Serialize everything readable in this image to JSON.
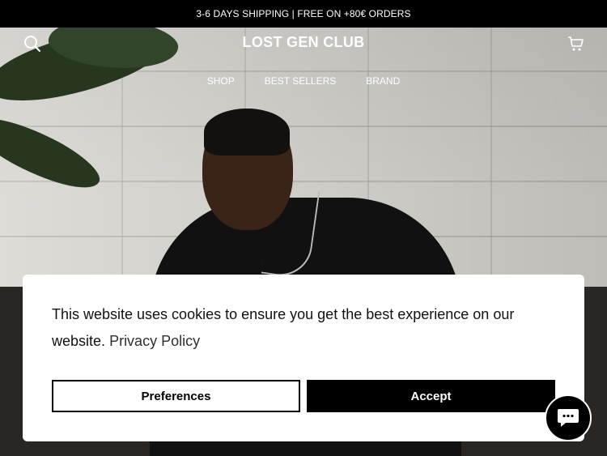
{
  "announcement": {
    "text": "3-6 DAYS SHIPPING | FREE ON +80€ ORDERS"
  },
  "header": {
    "logo": "LOST GEN CLUB",
    "search_icon": "search-icon",
    "cart_icon": "cart-icon"
  },
  "nav": {
    "items": [
      {
        "label": "SHOP"
      },
      {
        "label": "BEST SELLERS"
      },
      {
        "label": "BRAND"
      }
    ]
  },
  "cookie_banner": {
    "message": "This website uses cookies to ensure you get the best experience on our website.",
    "link_label": "Privacy Policy",
    "preferences_label": "Preferences",
    "accept_label": "Accept"
  },
  "chat": {
    "icon": "chat-icon"
  },
  "colors": {
    "announce_bg": "#000000",
    "accept_bg": "#000000",
    "banner_bg": "#ffffff"
  }
}
